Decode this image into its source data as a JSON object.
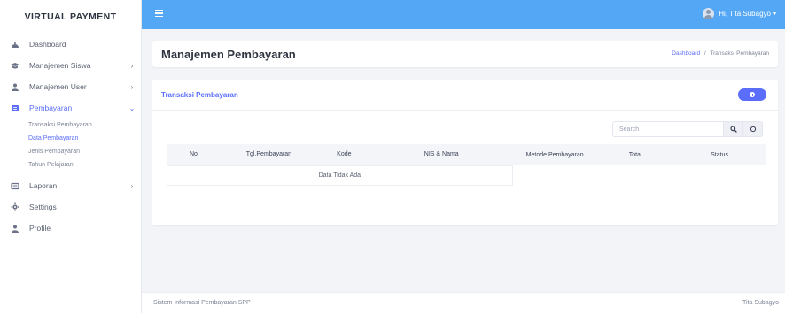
{
  "sidebar": {
    "brand": "VIRTUAL PAYMENT",
    "items": [
      {
        "label": "Dashboard",
        "icon": "dashboard-icon",
        "has_arrow": false
      },
      {
        "label": "Manajemen Siswa",
        "icon": "graduation-cap-icon",
        "has_arrow": true
      },
      {
        "label": "Manajemen User",
        "icon": "users-icon",
        "has_arrow": true
      },
      {
        "label": "Pembayaran",
        "icon": "wallet-icon",
        "has_arrow": true,
        "expanded": true,
        "active": true
      },
      {
        "label": "Laporan",
        "icon": "report-icon",
        "has_arrow": true
      },
      {
        "label": "Settings",
        "icon": "gear-icon",
        "has_arrow": false
      },
      {
        "label": "Profile",
        "icon": "user-icon",
        "has_arrow": false
      }
    ],
    "submenu": [
      {
        "label": "Transaksi Pembayaran"
      },
      {
        "label": "Data Pembayaran",
        "active": true
      },
      {
        "label": "Jenis Pembayaran"
      },
      {
        "label": "Tahun Pelajaran"
      }
    ],
    "arrow_right": "›",
    "arrow_down": "⌄"
  },
  "topbar": {
    "user_greeting": "Hi, Tita Subagyo",
    "caret": "▾"
  },
  "header": {
    "title": "Manajemen Pembayaran",
    "breadcrumb_home": "Dashboard",
    "breadcrumb_sep": "/",
    "breadcrumb_current": "Transaksi Pembayaran"
  },
  "card": {
    "title": "Transaksi Pembayaran",
    "search_placeholder": "Search",
    "columns": [
      "No",
      "Tgl.Pembayaran",
      "Kode",
      "NIS & Nama",
      "Metode Pembayaran",
      "Total",
      "Status"
    ],
    "empty_message": "Data Tidak Ada"
  },
  "footer": {
    "left": "Sistem Informasi Pembayaran SPP",
    "right": "Tita Subagyo"
  },
  "colors": {
    "accent": "#5a6dfb",
    "topbar": "#54a7f4",
    "background": "#f2f4f8"
  }
}
